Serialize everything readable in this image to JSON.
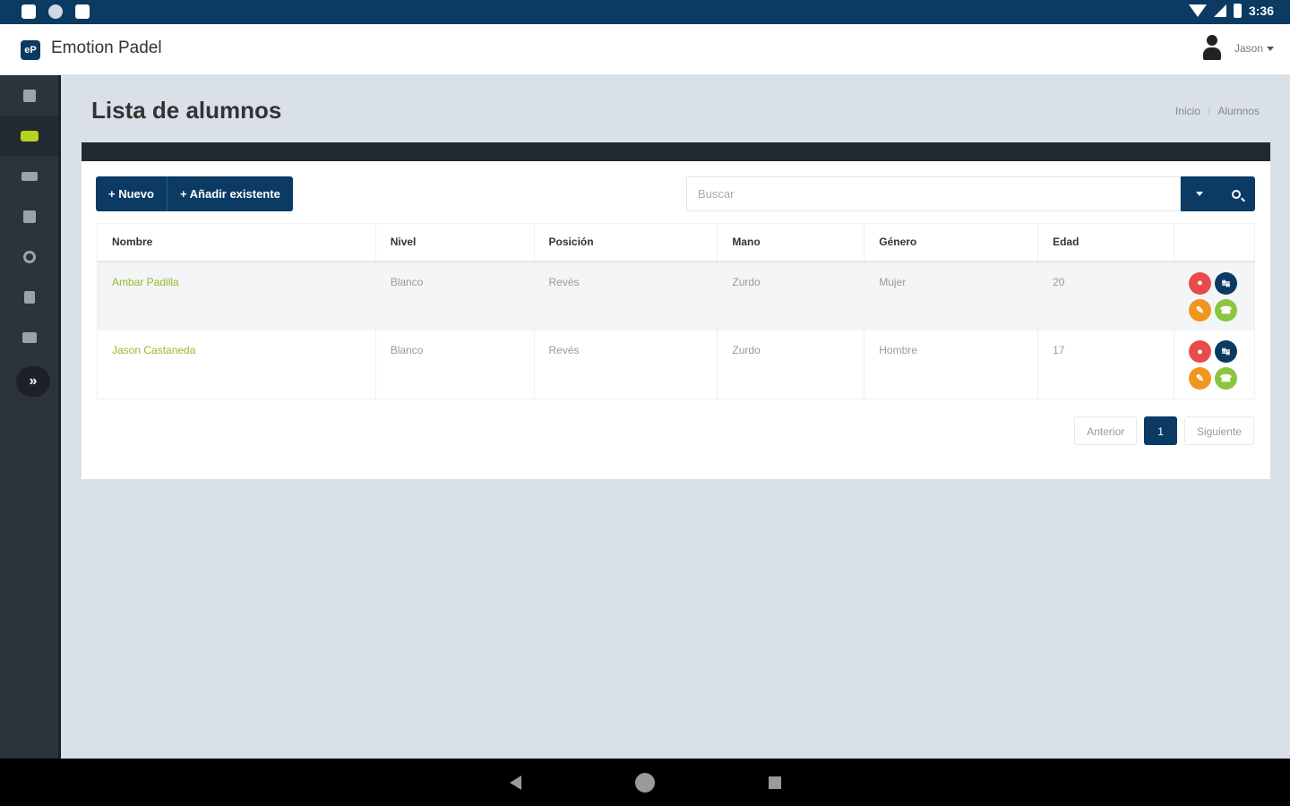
{
  "status_bar": {
    "time": "3:36"
  },
  "app": {
    "name": "Emotion Padel",
    "logo_text": "eP"
  },
  "user": {
    "name": "Jason"
  },
  "sidebar": {
    "items": [
      {
        "icon": "dashboard-icon"
      },
      {
        "icon": "crown-icon",
        "active": true
      },
      {
        "icon": "dumbbell-icon"
      },
      {
        "icon": "calendar-icon"
      },
      {
        "icon": "target-icon"
      },
      {
        "icon": "book-icon"
      },
      {
        "icon": "list-icon"
      }
    ],
    "expand_label": "»"
  },
  "page": {
    "title": "Lista de alumnos",
    "breadcrumb": [
      "Inicio",
      "Alumnos"
    ]
  },
  "toolbar": {
    "new_label": "+ Nuevo",
    "add_existing_label": "+ Añadir existente",
    "search_placeholder": "Buscar"
  },
  "table": {
    "headers": [
      "Nombre",
      "Nivel",
      "Posición",
      "Mano",
      "Género",
      "Edad",
      ""
    ],
    "rows": [
      {
        "nombre": "Ambar Padilla",
        "nivel": "Blanco",
        "posicion": "Revés",
        "mano": "Zurdo",
        "genero": "Mujer",
        "edad": "20"
      },
      {
        "nombre": "Jason Castaneda",
        "nivel": "Blanco",
        "posicion": "Revés",
        "mano": "Zurdo",
        "genero": "Hombre",
        "edad": "17"
      }
    ]
  },
  "pagination": {
    "prev": "Anterior",
    "current": "1",
    "next": "Siguiente"
  },
  "colors": {
    "primary": "#0b3a62",
    "accent": "#9ab82a",
    "sidebar": "#2c333b"
  }
}
